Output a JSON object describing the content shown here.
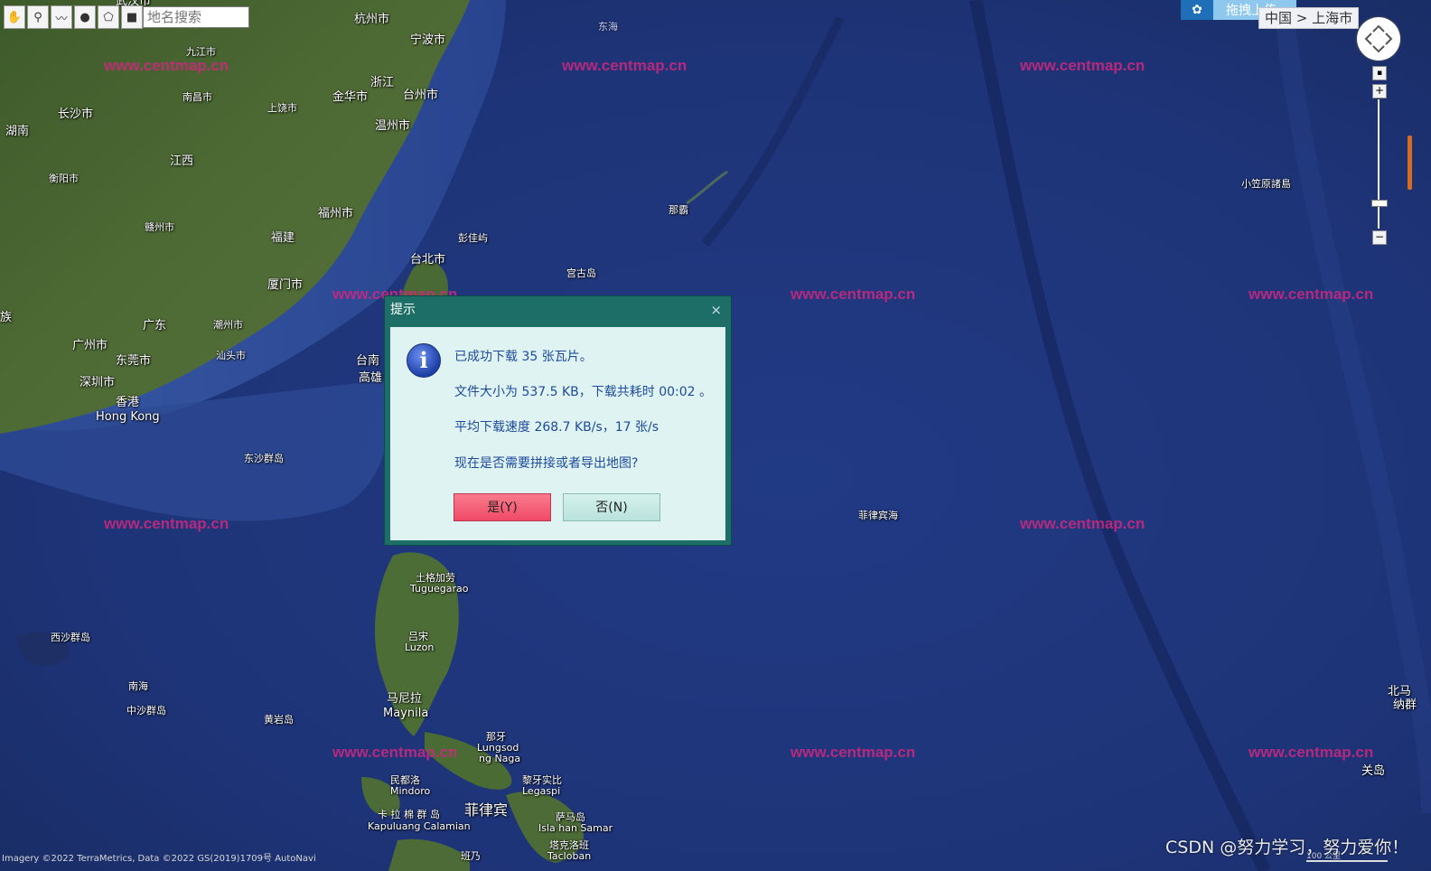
{
  "toolbar": {
    "tools": [
      {
        "name": "pan-hand-icon",
        "glyph": "✋"
      },
      {
        "name": "marker-pin-icon",
        "glyph": "⚲"
      },
      {
        "name": "polyline-icon",
        "glyph": "〰"
      },
      {
        "name": "circle-icon",
        "glyph": "●"
      },
      {
        "name": "polygon-icon",
        "glyph": "⬠"
      },
      {
        "name": "rectangle-icon",
        "glyph": "■"
      }
    ],
    "search_placeholder": "地名搜索"
  },
  "upload": {
    "label": "拖拽上传"
  },
  "breadcrumb": {
    "text": "中国 > 上海市"
  },
  "watermark": "www.centmap.cn",
  "places": [
    {
      "text": "杭州市",
      "cls": "mid"
    },
    {
      "text": "宁波市",
      "cls": "mid"
    },
    {
      "text": "九江市",
      "cls": "small"
    },
    {
      "text": "浙江",
      "cls": "mid"
    },
    {
      "text": "金华市",
      "cls": "mid"
    },
    {
      "text": "台州市",
      "cls": "mid"
    },
    {
      "text": "南昌市",
      "cls": "small"
    },
    {
      "text": "上饶市",
      "cls": "small"
    },
    {
      "text": "长沙市",
      "cls": "mid"
    },
    {
      "text": "湖南",
      "cls": "mid"
    },
    {
      "text": "温州市",
      "cls": "mid"
    },
    {
      "text": "江西",
      "cls": "mid"
    },
    {
      "text": "衡阳市",
      "cls": "small"
    },
    {
      "text": "福州市",
      "cls": "mid"
    },
    {
      "text": "赣州市",
      "cls": "small"
    },
    {
      "text": "福建",
      "cls": "mid"
    },
    {
      "text": "彭佳屿",
      "cls": "small"
    },
    {
      "text": "台北市",
      "cls": "mid"
    },
    {
      "text": "厦门市",
      "cls": "mid"
    },
    {
      "text": "广东",
      "cls": "mid"
    },
    {
      "text": "潮州市",
      "cls": "small"
    },
    {
      "text": "汕头市",
      "cls": "small"
    },
    {
      "text": "广州市",
      "cls": "mid"
    },
    {
      "text": "东莞市",
      "cls": "mid"
    },
    {
      "text": "深圳市",
      "cls": "mid"
    },
    {
      "text": "香港",
      "cls": "mid"
    },
    {
      "text": "Hong Kong",
      "cls": "mid"
    },
    {
      "text": "台南",
      "cls": "mid"
    },
    {
      "text": "高雄",
      "cls": "mid"
    },
    {
      "text": "东沙群岛",
      "cls": "small"
    },
    {
      "text": "那霸",
      "cls": "small"
    },
    {
      "text": "宫古岛",
      "cls": "small"
    },
    {
      "text": "小笠原諸島",
      "cls": "small"
    },
    {
      "text": "菲律宾海",
      "cls": "small"
    },
    {
      "text": "土格加劳",
      "cls": "small"
    },
    {
      "text": "Tuguegarao",
      "cls": "small"
    },
    {
      "text": "吕宋",
      "cls": "small"
    },
    {
      "text": "Luzon",
      "cls": "small"
    },
    {
      "text": "西沙群岛",
      "cls": "small"
    },
    {
      "text": "南海",
      "cls": "small"
    },
    {
      "text": "中沙群岛",
      "cls": "small"
    },
    {
      "text": "黄岩岛",
      "cls": "small"
    },
    {
      "text": "马尼拉",
      "cls": "mid"
    },
    {
      "text": "Maynila",
      "cls": "mid"
    },
    {
      "text": "那牙",
      "cls": "small"
    },
    {
      "text": "Lungsod",
      "cls": "small"
    },
    {
      "text": "ng Naga",
      "cls": "small"
    },
    {
      "text": "民都洛",
      "cls": "small"
    },
    {
      "text": "Mindoro",
      "cls": "small"
    },
    {
      "text": "黎牙实比",
      "cls": "small"
    },
    {
      "text": "Legaspi",
      "cls": "small"
    },
    {
      "text": "卡 拉 棉 群 岛",
      "cls": "small"
    },
    {
      "text": "Kapuluang Calamian",
      "cls": "small"
    },
    {
      "text": "菲律宾",
      "cls": "big"
    },
    {
      "text": "萨马岛",
      "cls": "small"
    },
    {
      "text": "Isla han Samar",
      "cls": "small"
    },
    {
      "text": "塔克洛班",
      "cls": "small"
    },
    {
      "text": "Tacloban",
      "cls": "small"
    },
    {
      "text": "班乃",
      "cls": "small"
    },
    {
      "text": "关岛",
      "cls": "mid"
    },
    {
      "text": "北马",
      "cls": "mid"
    },
    {
      "text": "纳群",
      "cls": "mid"
    },
    {
      "text": "东海",
      "cls": "small"
    },
    {
      "text": "武汉市",
      "cls": "mid"
    },
    {
      "text": "族",
      "cls": "mid"
    }
  ],
  "dialog": {
    "title": "提示",
    "close": "×",
    "line1": "已成功下载 35 张瓦片。",
    "line2": "文件大小为 537.5 KB，下载共耗时 00:02 。",
    "line3": "平均下载速度 268.7 KB/s，17 张/s",
    "line4": "现在是否需要拼接或者导出地图?",
    "yes_label": "是(Y)",
    "no_label": "否(N)"
  },
  "zoom": {
    "in": "+",
    "out": "−",
    "reset": "▪",
    "level_fraction": 0.2
  },
  "attribution": "Imagery ©2022 TerraMetrics, Data ©2022 GS(2019)1709号 AutoNavi",
  "scale": {
    "label": "100 公里"
  },
  "csdn": "CSDN @努力学习，努力爱你！"
}
